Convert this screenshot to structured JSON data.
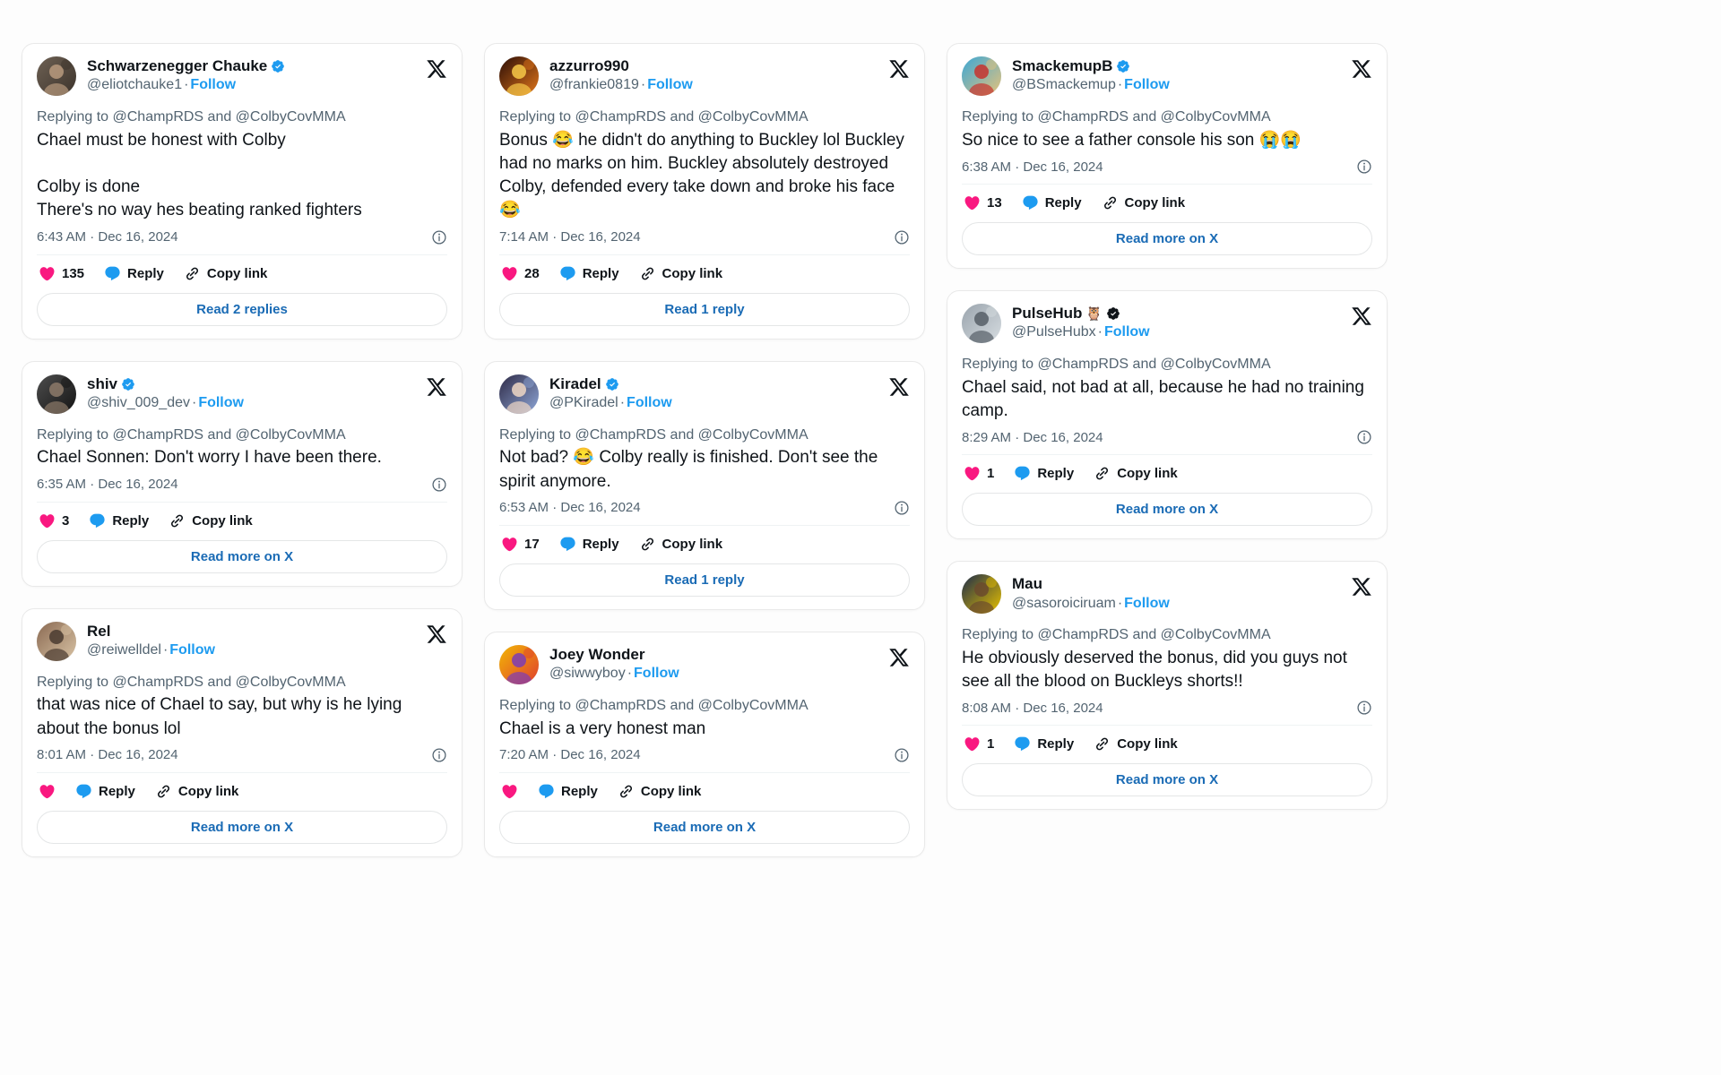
{
  "page": {
    "background": "#fdfdfd",
    "accent_blue": "#1d9bf0",
    "like_pink": "#f91880",
    "reply_blue": "#1d9bf0",
    "text_primary": "#0f1419",
    "text_secondary": "#536471",
    "link_blue": "#1a6bb5"
  },
  "labels": {
    "reply": "Reply",
    "copy_link": "Copy link",
    "follow": "Follow",
    "dot": "·",
    "replying_to": "Replying to @ChampRDS and @ColbyCovMMA"
  },
  "icons": {
    "x_logo": "x-logo-icon",
    "heart": "heart-icon",
    "reply_bubble": "reply-bubble-icon",
    "link_chain": "link-chain-icon",
    "info": "info-circle-icon",
    "verified_blue": "verified-badge-icon",
    "verified_black": "verified-affiliate-badge-icon"
  },
  "columns": [
    {
      "cards": [
        {
          "display_name": "Schwarzenegger Chauke",
          "verified": "blue",
          "name_emoji": "",
          "handle": "@eliotchauke1",
          "avatar_style": "photo-person-dark",
          "replying_to": "Replying to @ChampRDS and @ColbyCovMMA",
          "text": "Chael must be honest with Colby\n\nColby is done\nThere's no way hes beating ranked fighters",
          "timestamp": "6:43 AM · Dec 16, 2024",
          "like_count": "135",
          "footer_label": "Read 2 replies"
        },
        {
          "display_name": "shiv",
          "verified": "blue",
          "name_emoji": "",
          "handle": "@shiv_009_dev",
          "avatar_style": "photo-person-black",
          "replying_to": "Replying to @ChampRDS and @ColbyCovMMA",
          "text": "Chael Sonnen: Don't worry I have been there.",
          "timestamp": "6:35 AM · Dec 16, 2024",
          "like_count": "3",
          "footer_label": "Read more on X"
        },
        {
          "display_name": "Rel",
          "verified": "none",
          "name_emoji": "",
          "handle": "@reiwelldel",
          "avatar_style": "photo-warm",
          "replying_to": "Replying to @ChampRDS and @ColbyCovMMA",
          "text": "that was nice of Chael to say, but why is he lying about the bonus lol",
          "timestamp": "8:01 AM · Dec 16, 2024",
          "like_count": "",
          "footer_label": "Read more on X"
        }
      ]
    },
    {
      "cards": [
        {
          "display_name": "azzurro990",
          "verified": "none",
          "name_emoji": "",
          "handle": "@frankie0819",
          "avatar_style": "photo-fire",
          "replying_to": "Replying to @ChampRDS and @ColbyCovMMA",
          "text": "Bonus 😂 he didn't do anything to Buckley lol Buckley had no marks on him. Buckley absolutely destroyed Colby, defended every take down and broke his face 😂",
          "timestamp": "7:14 AM · Dec 16, 2024",
          "like_count": "28",
          "footer_label": "Read 1 reply"
        },
        {
          "display_name": "Kiradel",
          "verified": "blue",
          "name_emoji": "",
          "handle": "@PKiradel",
          "avatar_style": "photo-anime",
          "replying_to": "Replying to @ChampRDS and @ColbyCovMMA",
          "text": "Not bad? 😂 Colby really is finished. Don't see the spirit anymore.",
          "timestamp": "6:53 AM · Dec 16, 2024",
          "like_count": "17",
          "footer_label": "Read 1 reply"
        },
        {
          "display_name": "Joey Wonder",
          "verified": "none",
          "name_emoji": "",
          "handle": "@siwwyboy",
          "avatar_style": "photo-rainbow",
          "replying_to": "Replying to @ChampRDS and @ColbyCovMMA",
          "text": "Chael is a very honest man",
          "timestamp": "7:20 AM · Dec 16, 2024",
          "like_count": "",
          "footer_label": "Read more on X"
        }
      ]
    },
    {
      "cards": [
        {
          "display_name": "SmackemupB",
          "verified": "blue",
          "name_emoji": "",
          "handle": "@BSmackemup",
          "avatar_style": "photo-anime-straw",
          "replying_to": "Replying to @ChampRDS and @ColbyCovMMA",
          "text": "So nice to see a father console his son 😭😭",
          "timestamp": "6:38 AM · Dec 16, 2024",
          "like_count": "13",
          "footer_label": "Read more on X"
        },
        {
          "display_name": "PulseHub",
          "verified": "black",
          "name_emoji": "🦉",
          "handle": "@PulseHubx",
          "avatar_style": "photo-grey-statue",
          "replying_to": "Replying to @ChampRDS and @ColbyCovMMA",
          "text": "Chael said, not bad at all, because he had no training camp.",
          "timestamp": "8:29 AM · Dec 16, 2024",
          "like_count": "1",
          "footer_label": "Read more on X"
        },
        {
          "display_name": "Mau",
          "verified": "none",
          "name_emoji": "",
          "handle": "@sasoroiciruam",
          "avatar_style": "photo-yellow",
          "replying_to": "Replying to @ChampRDS and @ColbyCovMMA",
          "text": "He obviously deserved the bonus, did you guys not see all the blood on Buckleys shorts!!",
          "timestamp": "8:08 AM · Dec 16, 2024",
          "like_count": "1",
          "footer_label": "Read more on X"
        }
      ]
    }
  ]
}
